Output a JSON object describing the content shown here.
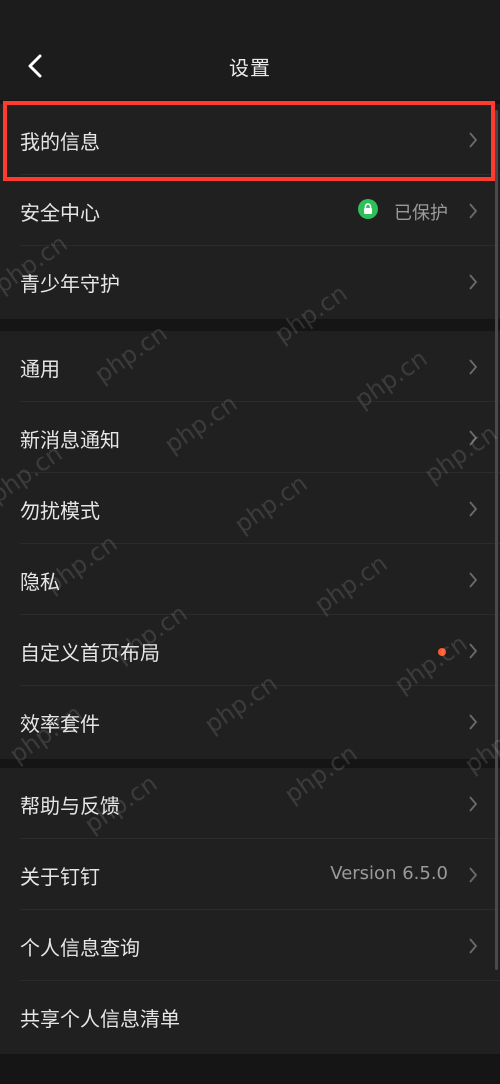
{
  "header": {
    "title": "设置"
  },
  "groups": [
    {
      "items": [
        {
          "label": "我的信息"
        },
        {
          "label": "安全中心",
          "status": "已保护",
          "status_icon": "lock-icon"
        },
        {
          "label": "青少年守护"
        }
      ]
    },
    {
      "items": [
        {
          "label": "通用"
        },
        {
          "label": "新消息通知"
        },
        {
          "label": "勿扰模式"
        },
        {
          "label": "隐私"
        },
        {
          "label": "自定义首页布局",
          "badge": "notification-dot"
        },
        {
          "label": "效率套件"
        }
      ]
    },
    {
      "items": [
        {
          "label": "帮助与反馈"
        },
        {
          "label": "关于钉钉",
          "value": "Version 6.5.0"
        },
        {
          "label": "个人信息查询"
        },
        {
          "label": "共享个人信息清单"
        }
      ]
    }
  ],
  "watermark": "php.cn",
  "colors": {
    "background": "#151515",
    "group_background": "#202020",
    "highlight": "#ff3b30",
    "secure_green": "#2fbf5a",
    "notification_dot": "#ff5a2c"
  }
}
